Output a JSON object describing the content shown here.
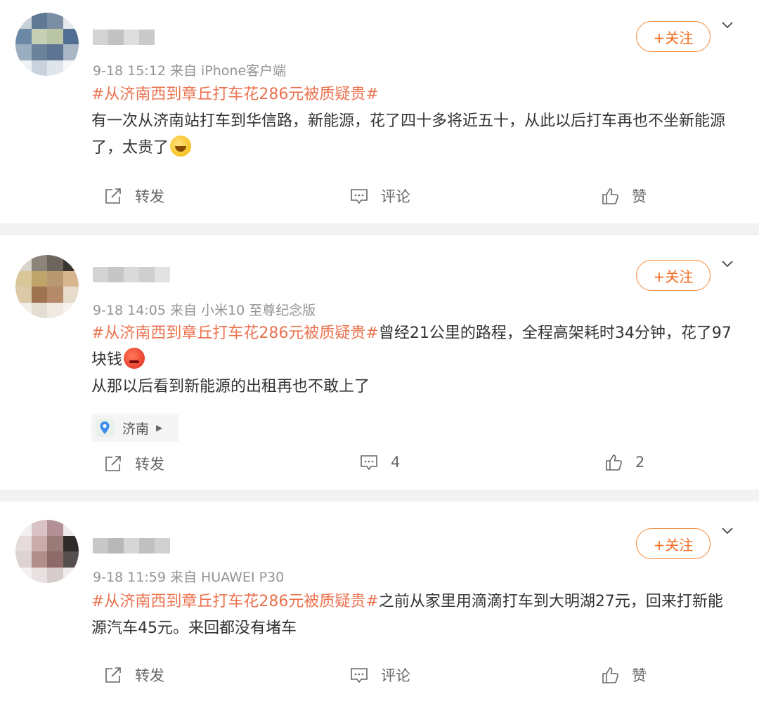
{
  "colors": {
    "accent": "#eb7350",
    "follow": "#f26b1d"
  },
  "posts": [
    {
      "meta": "9-18 15:12  来自 iPhone客户端",
      "follow_label": "+关注",
      "hashtag": "#从济南西到章丘打车花286元被质疑贵#",
      "body1": "有一次从济南站打车到华信路，新能源，花了四十多将近五十，从此以后打车再也不坐新能源了，太贵了",
      "emoji": "laugh-cry-emoji",
      "actions": {
        "repost": "转发",
        "comment": "评论",
        "like": "赞"
      }
    },
    {
      "meta": "9-18 14:05  来自 小米10 至尊纪念版",
      "follow_label": "+关注",
      "hashtag": "#从济南西到章丘打车花286元被质疑贵#",
      "body1": "曾经21公里的路程，全程高架耗时34分钟，花了97块钱",
      "emoji": "angry-emoji",
      "body2": "从那以后看到新能源的出租再也不敢上了",
      "location": "济南",
      "actions": {
        "repost": "转发",
        "comment": "4",
        "like": "2"
      }
    },
    {
      "meta": "9-18 11:59  来自 HUAWEI P30",
      "follow_label": "+关注",
      "hashtag": "#从济南西到章丘打车花286元被质疑贵#",
      "body1": "之前从家里用滴滴打车到大明湖27元，回来打新能源汽车45元。来回都没有堵车",
      "actions": {
        "repost": "转发",
        "comment": "评论",
        "like": "赞"
      }
    }
  ]
}
